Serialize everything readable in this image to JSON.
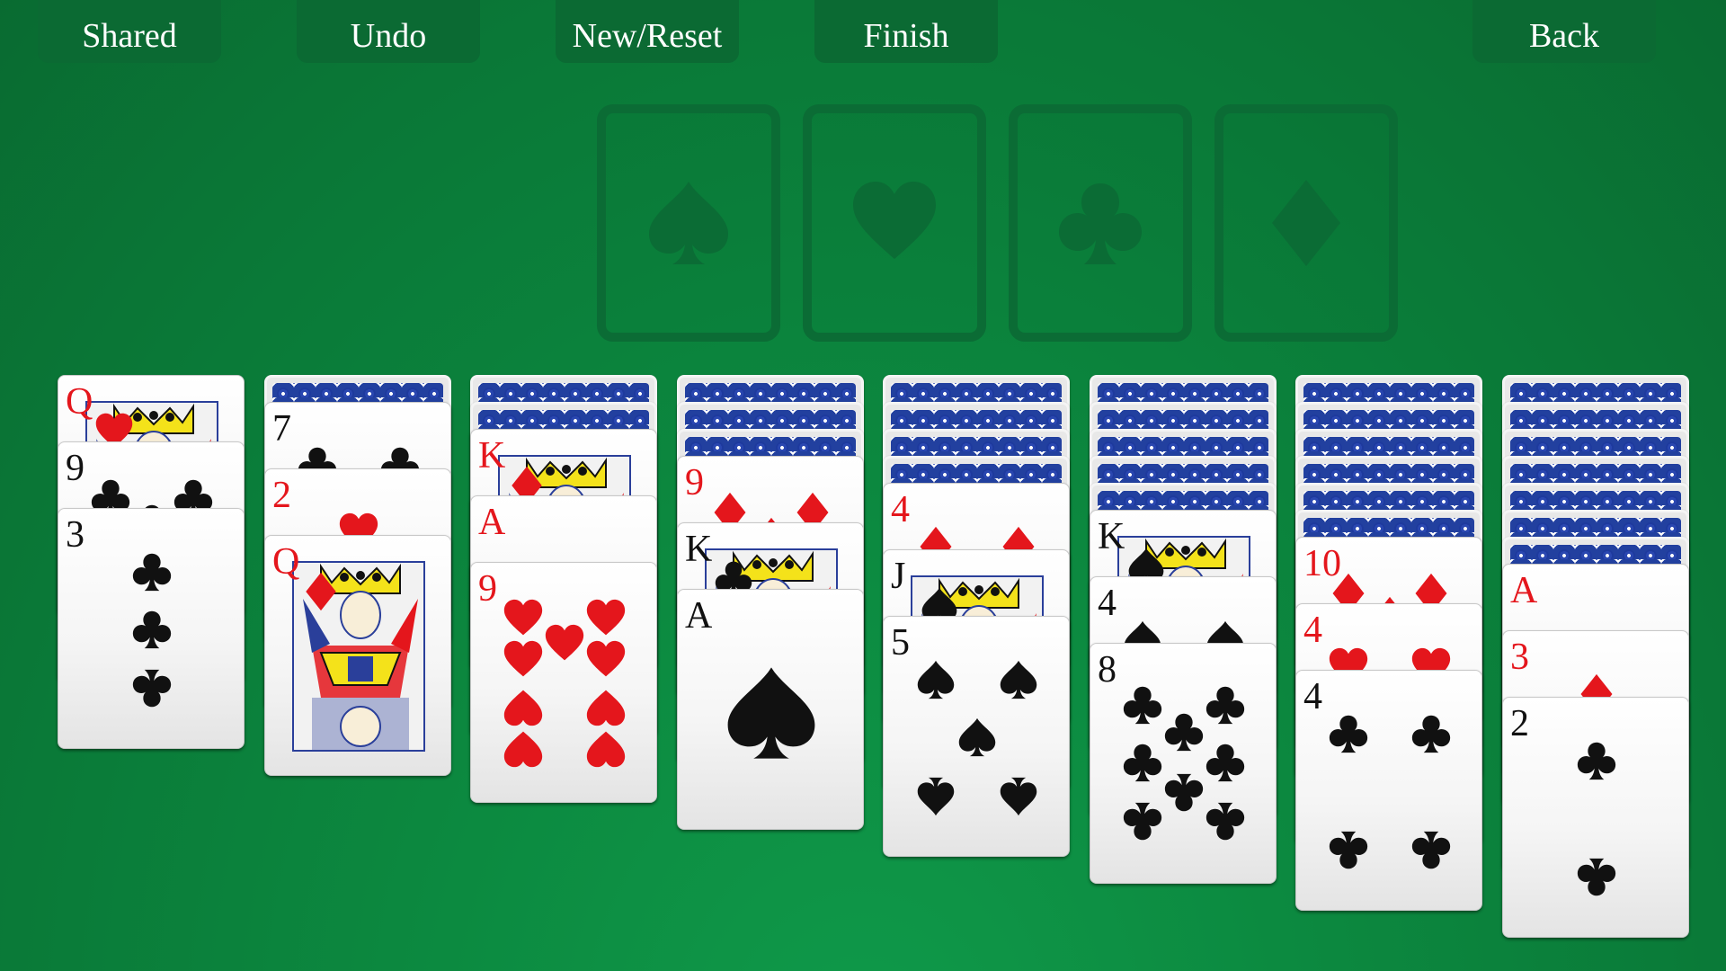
{
  "toolbar": {
    "shared_label": "Shared",
    "undo_label": "Undo",
    "new_reset_label": "New/Reset",
    "finish_label": "Finish",
    "back_label": "Back"
  },
  "colors": {
    "felt": "#0a7a38",
    "button": "#0b6a33",
    "foundation_outline": "#0b6c35",
    "red_suit": "#e4161c",
    "black_suit": "#111111",
    "card_back": "#22409f"
  },
  "foundations": [
    {
      "suit": "spade"
    },
    {
      "suit": "heart"
    },
    {
      "suit": "club"
    },
    {
      "suit": "diamond"
    }
  ],
  "tableau": [
    {
      "face_down": 0,
      "face_up": [
        {
          "rank": "Q",
          "suit": "heart"
        },
        {
          "rank": "9",
          "suit": "club"
        },
        {
          "rank": "3",
          "suit": "club"
        }
      ]
    },
    {
      "face_down": 1,
      "face_up": [
        {
          "rank": "7",
          "suit": "club"
        },
        {
          "rank": "2",
          "suit": "heart"
        },
        {
          "rank": "Q",
          "suit": "diamond"
        }
      ]
    },
    {
      "face_down": 2,
      "face_up": [
        {
          "rank": "K",
          "suit": "diamond"
        },
        {
          "rank": "A",
          "suit": "heart"
        },
        {
          "rank": "9",
          "suit": "heart"
        }
      ]
    },
    {
      "face_down": 3,
      "face_up": [
        {
          "rank": "9",
          "suit": "diamond"
        },
        {
          "rank": "K",
          "suit": "club"
        },
        {
          "rank": "A",
          "suit": "spade"
        }
      ]
    },
    {
      "face_down": 4,
      "face_up": [
        {
          "rank": "4",
          "suit": "diamond"
        },
        {
          "rank": "J",
          "suit": "spade"
        },
        {
          "rank": "5",
          "suit": "spade"
        }
      ]
    },
    {
      "face_down": 5,
      "face_up": [
        {
          "rank": "K",
          "suit": "spade"
        },
        {
          "rank": "4",
          "suit": "spade"
        },
        {
          "rank": "8",
          "suit": "club"
        }
      ]
    },
    {
      "face_down": 6,
      "face_up": [
        {
          "rank": "10",
          "suit": "diamond"
        },
        {
          "rank": "4",
          "suit": "heart"
        },
        {
          "rank": "4",
          "suit": "club"
        }
      ]
    },
    {
      "face_down": 7,
      "face_up": [
        {
          "rank": "A",
          "suit": "diamond"
        },
        {
          "rank": "3",
          "suit": "diamond"
        },
        {
          "rank": "2",
          "suit": "club"
        }
      ]
    }
  ]
}
